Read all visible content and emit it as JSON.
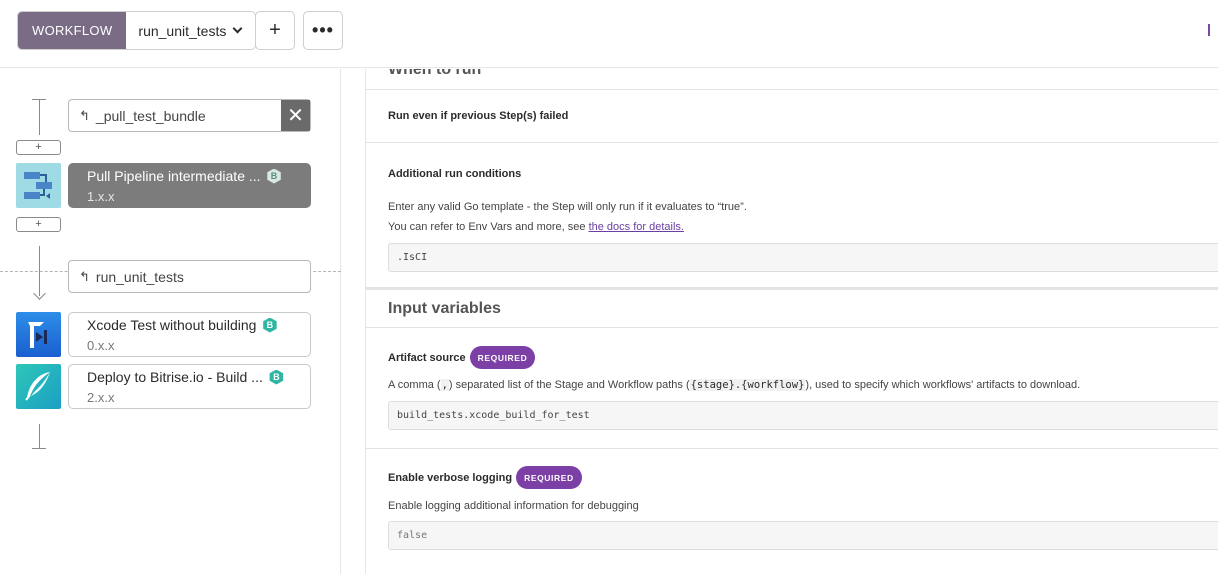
{
  "topbar": {
    "workflow_label": "WORKFLOW",
    "workflow_selected": "run_unit_tests",
    "add_label": "+",
    "more_label": "•••"
  },
  "left": {
    "chips": [
      {
        "name": "_pull_test_bundle",
        "ret_glyph": "↰"
      },
      {
        "name": "run_unit_tests",
        "ret_glyph": "↰"
      }
    ],
    "close_glyph": "✕",
    "plus_glyph": "+",
    "steps": [
      {
        "title": "Pull Pipeline intermediate ...",
        "version": "1.x.x",
        "badge": "B",
        "selected": true,
        "icon": "pipeline-icon"
      },
      {
        "title": "Xcode Test without building",
        "version": "0.x.x",
        "badge": "B",
        "selected": false,
        "icon": "xcode-test-icon"
      },
      {
        "title": "Deploy to Bitrise.io - Build ...",
        "version": "2.x.x",
        "badge": "B",
        "selected": false,
        "icon": "deploy-icon"
      }
    ]
  },
  "right": {
    "when_to_run": {
      "heading": "When to run",
      "run_even_label": "Run even if previous Step(s) failed",
      "conditions_label": "Additional run conditions",
      "conditions_desc1": "Enter any valid Go template - the Step will only run if it evaluates to “true”.",
      "conditions_desc2_prefix": "You can refer to Env Vars and more, see ",
      "conditions_desc2_link": "the docs for details.",
      "conditions_value": ".IsCI"
    },
    "inputs": {
      "heading": "Input variables",
      "artifact": {
        "label": "Artifact source",
        "badge": "REQUIRED",
        "desc_a": "A comma (",
        "desc_code1": ",",
        "desc_b": ") separated list of the Stage and Workflow paths (",
        "desc_code2": "{stage}.{workflow}",
        "desc_c": "), used to specify which workflows' artifacts to download.",
        "value": "build_tests.xcode_build_for_test"
      },
      "verbose": {
        "label": "Enable verbose logging",
        "badge": "REQUIRED",
        "desc": "Enable logging additional information for debugging",
        "value": "false"
      }
    }
  },
  "colors": {
    "workflow_label_bg": "#7b6c86",
    "required_badge": "#7b3fa6",
    "step_badge": "#2fb6a3",
    "selected_step_bg": "#7c7c7c",
    "link": "#6a3fa0"
  }
}
